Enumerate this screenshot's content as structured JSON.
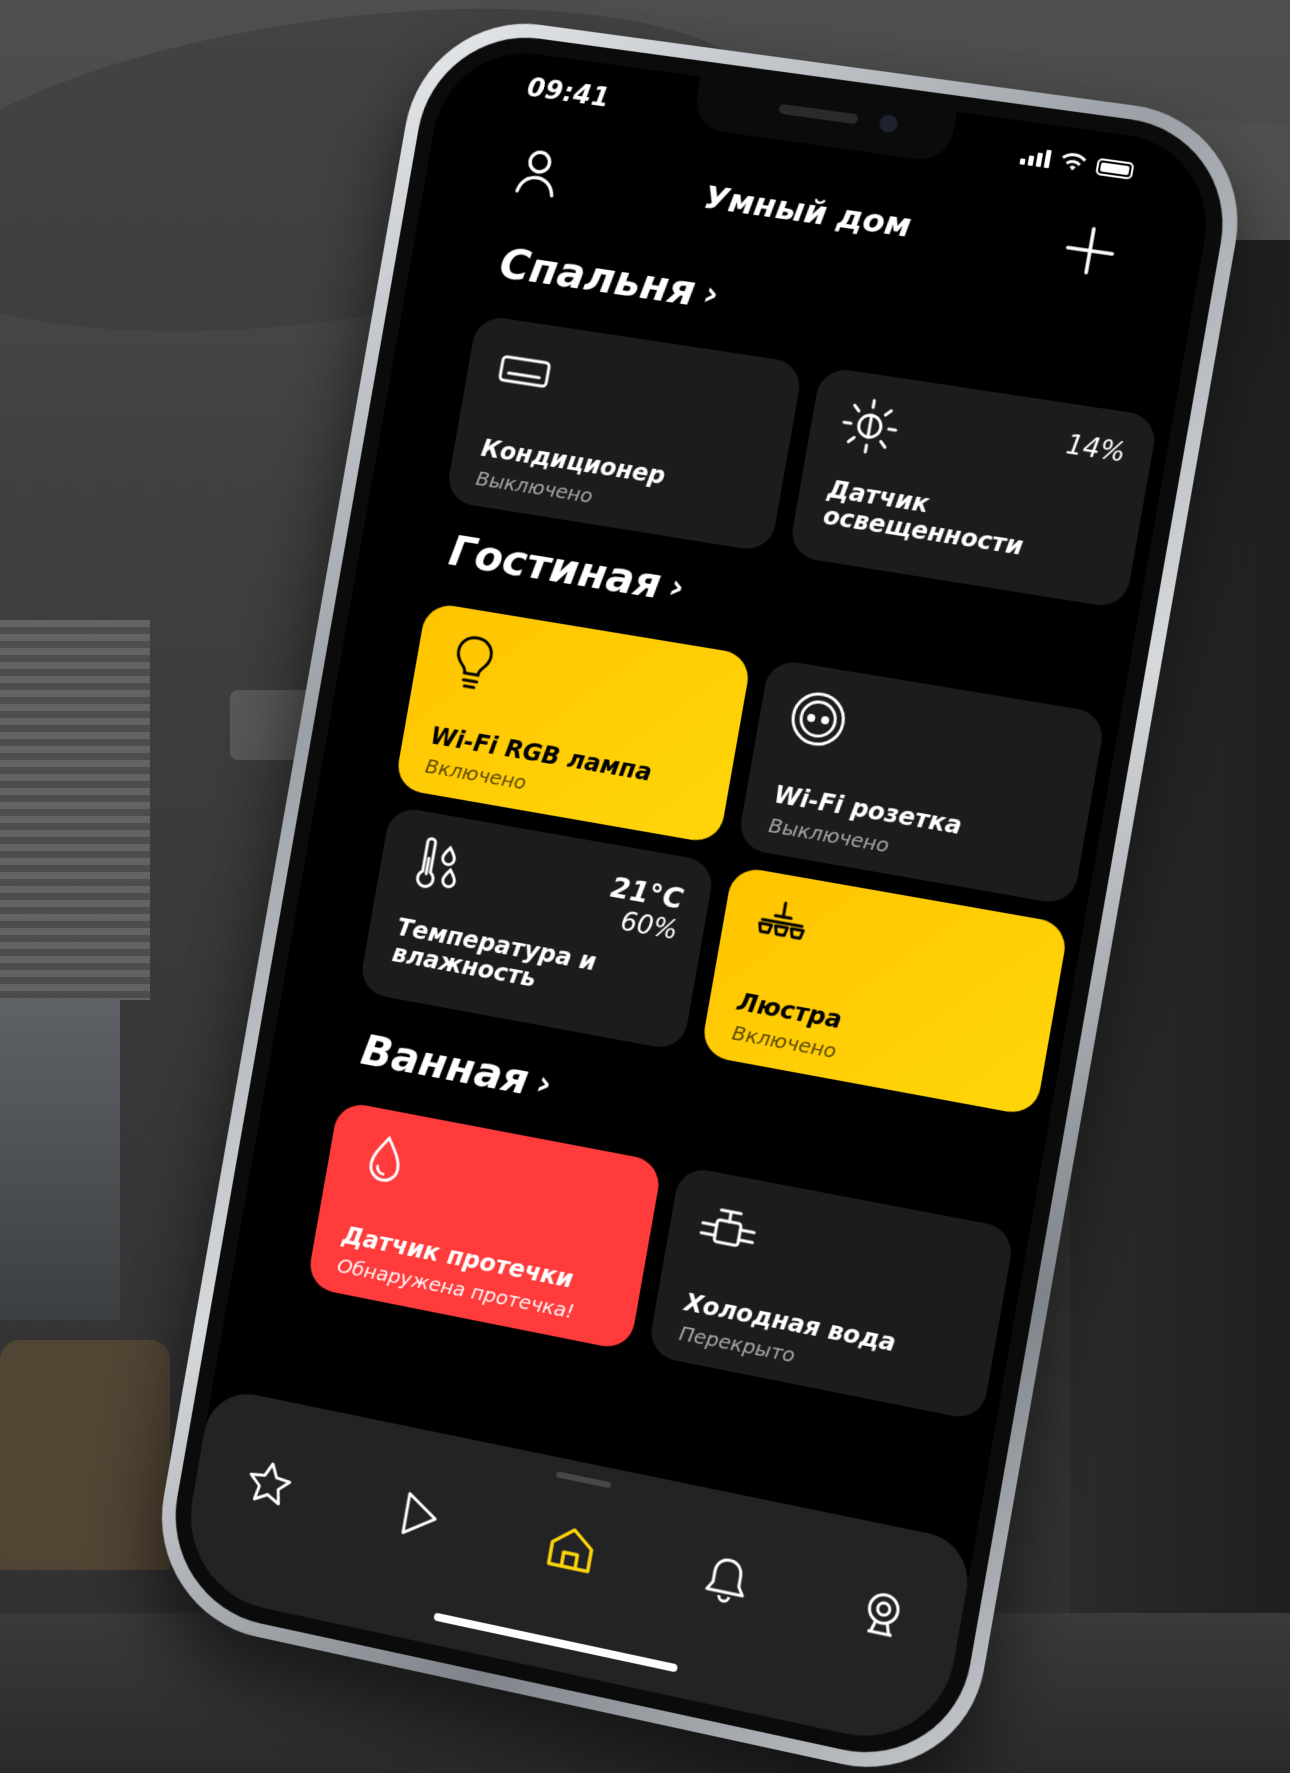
{
  "status_bar": {
    "time": "09:41"
  },
  "header": {
    "title": "Умный дом",
    "user_icon": "user-icon",
    "add_icon": "plus-icon"
  },
  "colors": {
    "accent": "#FFD60A",
    "accent_orange": "#FFC400",
    "alert": "#FF3B3B",
    "card_bg": "#1C1C1E",
    "screen_bg": "#000000"
  },
  "sections": [
    {
      "title": "Спальня",
      "chevron": "›",
      "devices": [
        {
          "name": "Кондиционер",
          "state": "Выключено",
          "icon": "air-conditioner-icon",
          "active": false
        },
        {
          "name_line1": "Датчик",
          "name_line2": "освещенности",
          "value": "14%",
          "icon": "light-sensor-icon",
          "active": false
        }
      ]
    },
    {
      "title": "Гостиная",
      "chevron": "›",
      "devices": [
        {
          "name": "Wi-Fi RGB лампа",
          "state": "Включено",
          "icon": "lightbulb-icon",
          "active": true
        },
        {
          "name": "Wi-Fi розетка",
          "state": "Выключено",
          "icon": "socket-icon",
          "active": false
        },
        {
          "name_line1": "Температура и",
          "name_line2": "влажность",
          "value_temp": "21°C",
          "value_humidity": "60%",
          "icon": "thermometer-droplets-icon",
          "active": false
        },
        {
          "name": "Люстра",
          "state": "Включено",
          "icon": "chandelier-icon",
          "active": true
        }
      ]
    },
    {
      "title": "Ванная",
      "chevron": "›",
      "devices": [
        {
          "name": "Датчик протечки",
          "state": "Обнаружена протечка!",
          "icon": "water-drop-icon",
          "alert": true
        },
        {
          "name": "Холодная вода",
          "state": "Перекрыто",
          "icon": "water-valve-icon",
          "active": false
        }
      ]
    }
  ],
  "tab_bar": {
    "tabs": [
      {
        "icon": "star-icon",
        "active": false
      },
      {
        "icon": "play-icon",
        "active": false
      },
      {
        "icon": "home-icon",
        "active": true
      },
      {
        "icon": "bell-icon",
        "active": false
      },
      {
        "icon": "camera-icon",
        "active": false
      }
    ]
  }
}
